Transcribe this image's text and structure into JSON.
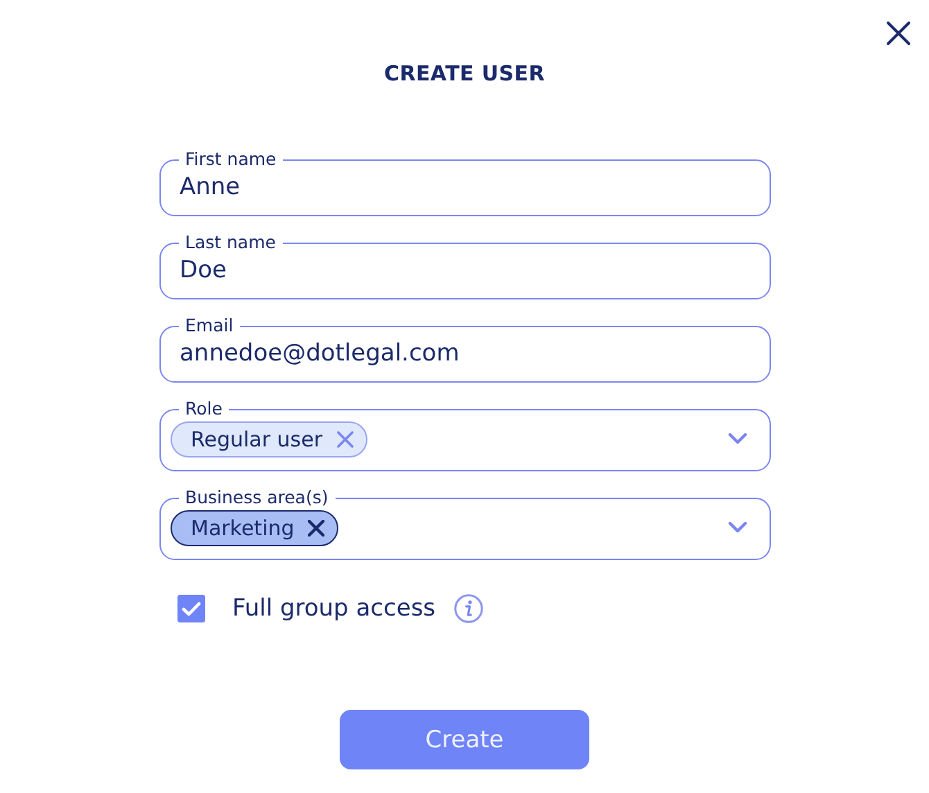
{
  "dialog": {
    "title": "CREATE USER"
  },
  "fields": [
    {
      "kind": "text",
      "label": "First name",
      "value": "Anne"
    },
    {
      "kind": "text",
      "label": "Last name",
      "value": "Doe"
    },
    {
      "kind": "text",
      "label": "Email",
      "value": "annedoe@dotlegal.com"
    },
    {
      "kind": "select",
      "label": "Role",
      "chips": [
        {
          "label": "Regular user",
          "selected": false
        }
      ]
    },
    {
      "kind": "select",
      "label": "Business area(s)",
      "chips": [
        {
          "label": "Marketing",
          "selected": true
        }
      ]
    }
  ],
  "full_group_access": {
    "label": "Full group access",
    "checked": true
  },
  "submit": {
    "label": "Create"
  }
}
